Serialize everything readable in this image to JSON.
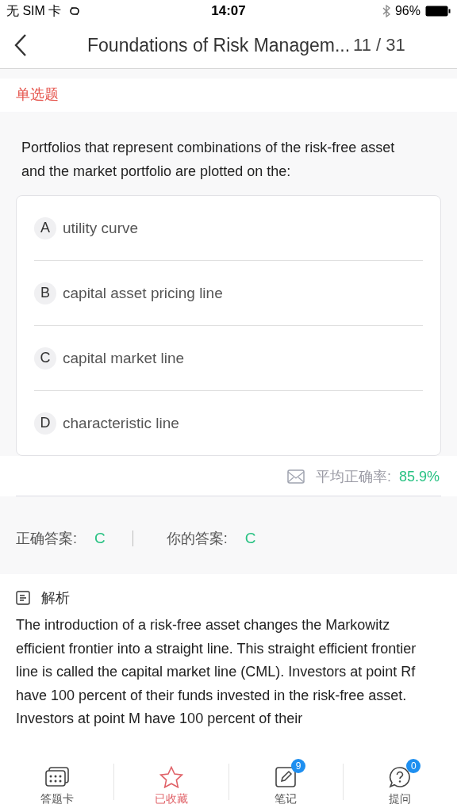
{
  "status_bar": {
    "carrier": "无 SIM 卡",
    "time": "14:07",
    "battery": "96%"
  },
  "nav": {
    "title": "Foundations of Risk Managem...",
    "progress": "11 / 31"
  },
  "question": {
    "type": "单选题",
    "text": "Portfolios that represent combinations of the risk-free asset and the market portfolio are plotted on the:",
    "options": [
      {
        "letter": "A",
        "text": "utility curve"
      },
      {
        "letter": "B",
        "text": "capital asset pricing line"
      },
      {
        "letter": "C",
        "text": "capital market line"
      },
      {
        "letter": "D",
        "text": "characteristic line"
      }
    ]
  },
  "accuracy": {
    "label": "平均正确率:",
    "value": "85.9%"
  },
  "answers": {
    "correct_label": "正确答案:",
    "correct": "C",
    "yours_label": "你的答案:",
    "yours": "C"
  },
  "analysis": {
    "heading": "解析",
    "text": "The introduction of a risk-free asset changes the Markowitz efficient frontier into a straight line. This straight efficient frontier line is called the capital market line (CML). Investors at point Rf have 100 percent of their funds invested in the risk-free asset. Investors at point M have 100 percent of their"
  },
  "bottom_bar": [
    {
      "kind": "card",
      "label": "答题卡",
      "active": false
    },
    {
      "kind": "star",
      "label": "已收藏",
      "active": true
    },
    {
      "kind": "note",
      "label": "笔记",
      "active": false,
      "badge": "9"
    },
    {
      "kind": "ask",
      "label": "提问",
      "active": false,
      "badge": "0"
    }
  ]
}
